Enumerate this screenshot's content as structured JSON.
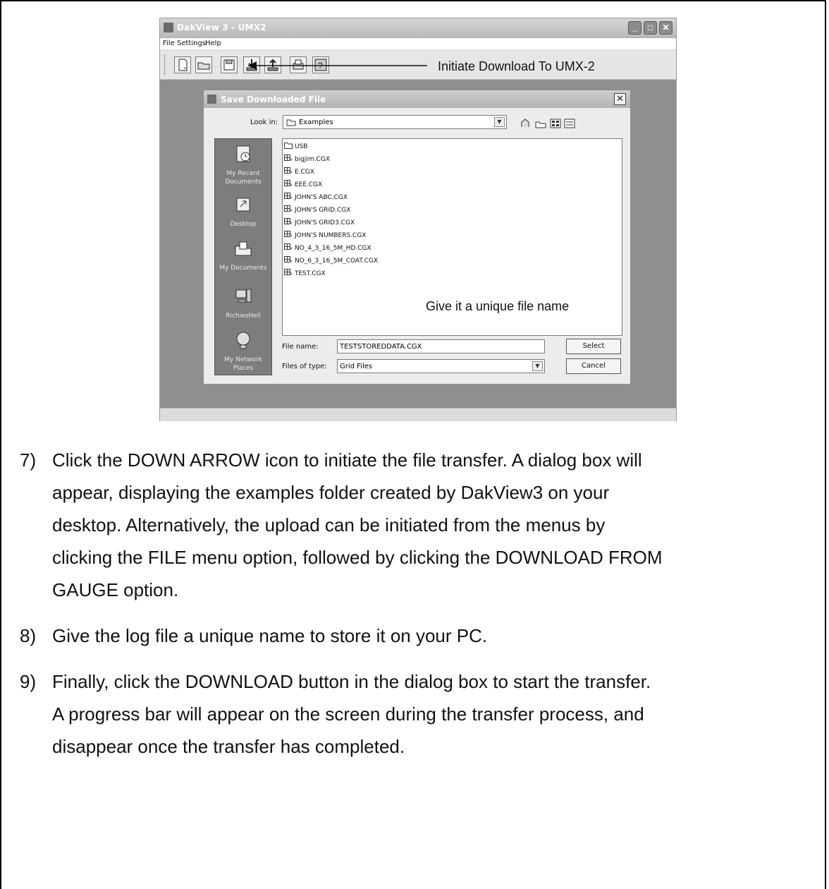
{
  "app_window": {
    "title": "DakView 3 - UMX2",
    "menu": [
      "File",
      "Settings",
      "Help"
    ],
    "toolbar_icons": [
      "new-file-icon",
      "open-folder-icon",
      "save-icon",
      "download-icon",
      "upload-icon",
      "print-icon",
      "help-icon"
    ]
  },
  "callouts": {
    "download": "Initiate Download To UMX-2",
    "filename": "Give it a unique file name"
  },
  "dialog": {
    "title": "Save Downloaded File",
    "look_in_label": "Look in:",
    "look_in_value": "Examples",
    "places": [
      "My Recent Documents",
      "Desktop",
      "My Documents",
      "RichiesHell",
      "My Network Places"
    ],
    "files": [
      "USB",
      "bigjim.CGX",
      "E.CGX",
      "EEE.CGX",
      "JOHN'S ABC.CGX",
      "JOHN'S GRID.CGX",
      "JOHN'S GRID3.CGX",
      "JOHN'S NUMBERS.CGX",
      "NO_4_3_16_5M_HD.CGX",
      "NO_6_3_16_5M_COAT.CGX",
      "TEST.CGX"
    ],
    "file_name_label": "File name:",
    "file_name_value": "TESTSTOREDDATA.CGX",
    "file_type_label": "Files of type:",
    "file_type_value": "Grid Files",
    "select_button": "Select",
    "cancel_button": "Cancel"
  },
  "instructions": [
    {
      "num": "7)",
      "lines": [
        "Click the DOWN ARROW icon to initiate the file transfer.  A dialog box will",
        "appear, displaying the examples folder created by DakView3 on your",
        "desktop.  Alternatively, the upload can be initiated from the menus by",
        "clicking the FILE menu option, followed by clicking the DOWNLOAD FROM",
        "GAUGE option."
      ]
    },
    {
      "num": "8)",
      "lines": [
        "Give the log file a unique name to store it on your PC."
      ]
    },
    {
      "num": "9)",
      "lines": [
        "Finally, click the DOWNLOAD button in the dialog box to start the transfer.",
        "A progress bar will appear on the screen during the transfer process, and",
        "disappear once the transfer has completed."
      ]
    }
  ]
}
